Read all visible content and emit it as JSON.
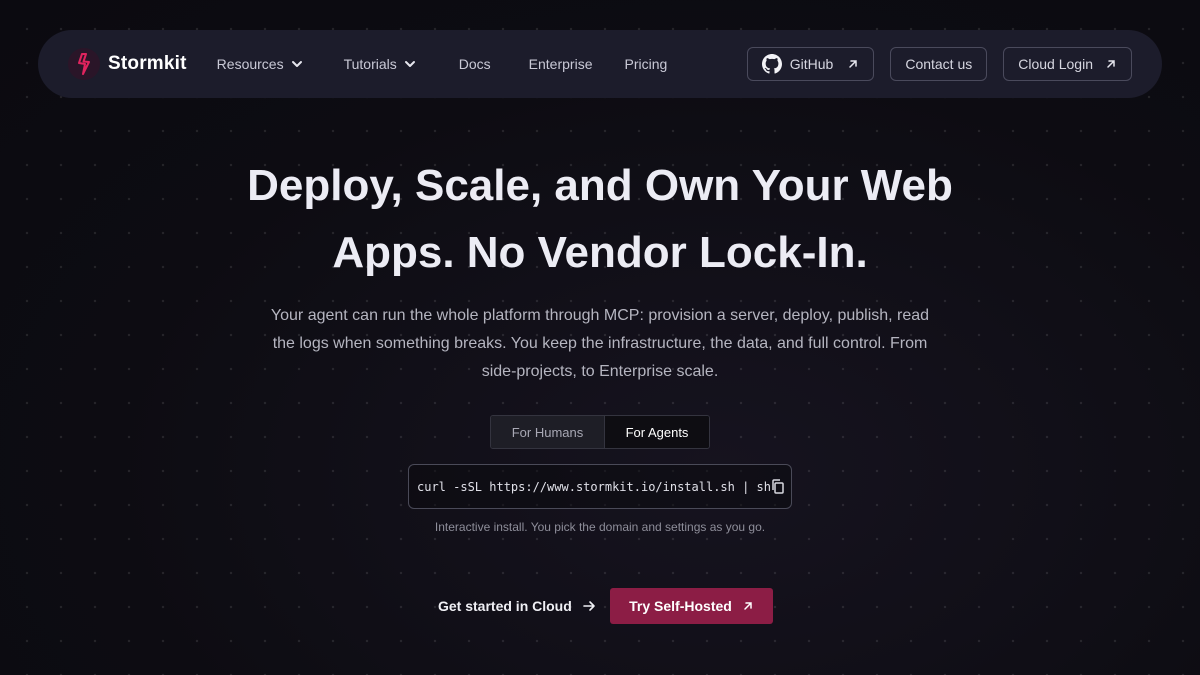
{
  "nav": {
    "brand": "Stormkit",
    "links": [
      {
        "label": "Resources",
        "has_dropdown": true
      },
      {
        "label": "Tutorials",
        "has_dropdown": true
      },
      {
        "label": "Docs",
        "has_dropdown": false
      },
      {
        "label": "Enterprise",
        "has_dropdown": false
      },
      {
        "label": "Pricing",
        "has_dropdown": false
      }
    ],
    "github_label": "GitHub",
    "contact_label": "Contact us",
    "cloud_login_label": "Cloud Login"
  },
  "hero": {
    "title_line1": "Deploy, Scale, and Own Your Web",
    "title_line2": "Apps. No Vendor Lock-In.",
    "subtitle": "Your agent can run the whole platform through MCP: provision a server, deploy, publish, read the logs when something breaks. You keep the infrastructure, the data, and full control. From side-projects, to Enterprise scale."
  },
  "install": {
    "tabs": [
      {
        "label": "For Humans",
        "active": false
      },
      {
        "label": "For Agents",
        "active": true
      }
    ],
    "command": "curl -sSL https://www.stormkit.io/install.sh | sh",
    "note": "Interactive install. You pick the domain and settings as you go."
  },
  "cta": {
    "cloud_label": "Get started in Cloud",
    "self_hosted_label": "Try Self-Hosted"
  },
  "colors": {
    "background": "#0d0c12",
    "navbar": "#1c1c2b",
    "accent": "#8c1d45",
    "logo_bolt": "#e0245e"
  },
  "icons": {
    "logo": "lightning-bolt-icon",
    "dropdown": "chevron-down-icon",
    "github": "github-icon",
    "external": "arrow-up-right-icon",
    "copy": "copy-icon",
    "arrow": "arrow-right-icon"
  }
}
